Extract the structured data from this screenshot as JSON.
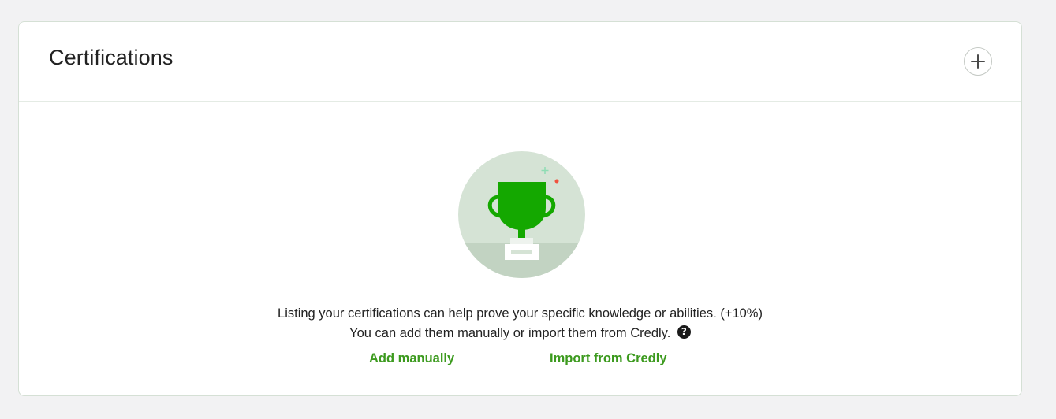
{
  "section": {
    "title": "Certifications",
    "add_icon": "plus-icon"
  },
  "empty_state": {
    "illustration_icon": "trophy-icon",
    "line1": "Listing your certifications can help prove your specific knowledge or abilities. (+10%)",
    "line2": "You can add them manually or import them from Credly.",
    "help_icon": "question-icon",
    "help_glyph": "?"
  },
  "actions": {
    "add_manually": "Add manually",
    "import_credly": "Import from Credly"
  },
  "colors": {
    "accent": "#3c9a1e",
    "trophy": "#14a800",
    "background": "#f2f2f3"
  }
}
